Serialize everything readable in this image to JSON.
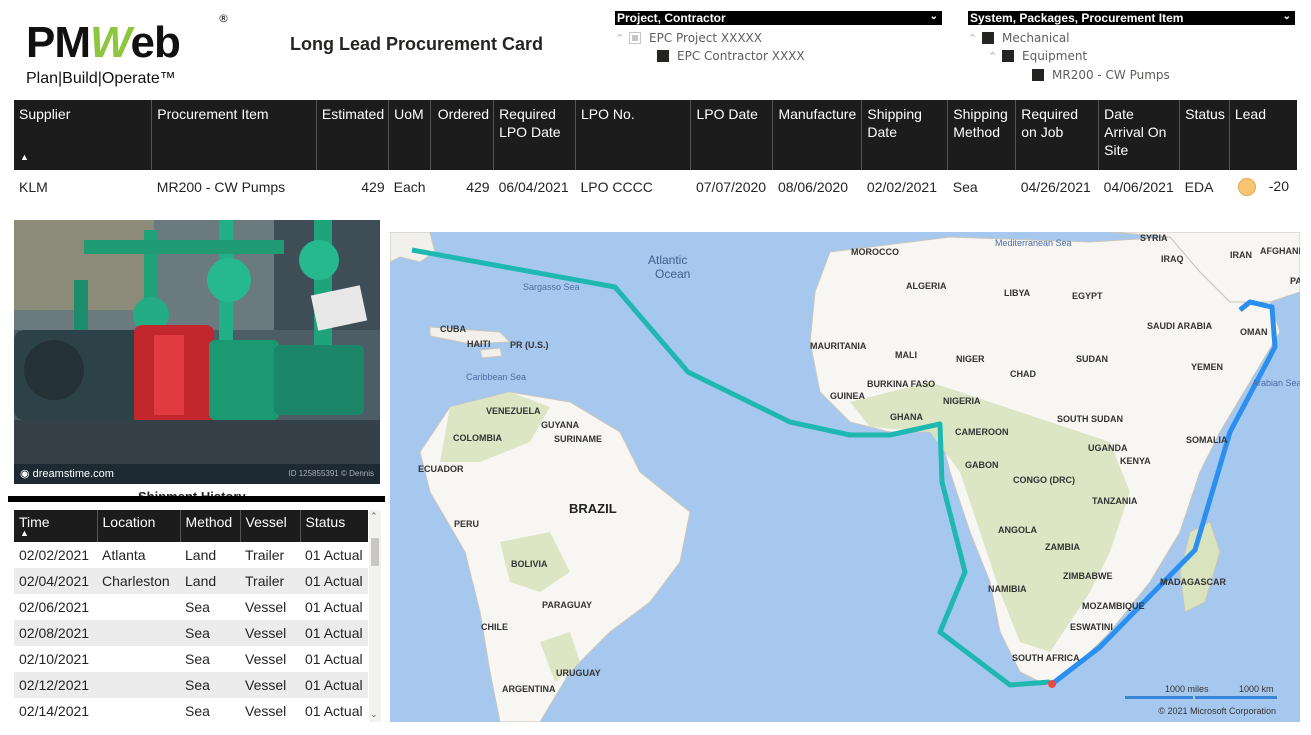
{
  "header": {
    "logo_pm": "PM",
    "logo_w": "W",
    "logo_eb": "eb",
    "logo_reg": "®",
    "logo_tagline": "Plan|Build|Operate™",
    "title": "Long Lead Procurement Card"
  },
  "slicer_project": {
    "title": "Project, Contractor",
    "items": [
      "EPC Project XXXXX",
      "EPC Contractor XXXX"
    ]
  },
  "slicer_system": {
    "title": "System, Packages, Procurement Item",
    "items": [
      "Mechanical",
      "Equipment",
      "MR200 - CW Pumps"
    ]
  },
  "procurement_table": {
    "columns": [
      "Supplier",
      "Procurement Item",
      "Estimated",
      "UoM",
      "Ordered",
      "Required LPO Date",
      "LPO No.",
      "LPO Date",
      "Manufacture",
      "Shipping Date",
      "Shipping Method",
      "Required on Job",
      "Date Arrival On Site",
      "Status",
      "Lead"
    ],
    "row": {
      "supplier": "KLM",
      "item": "MR200 - CW Pumps",
      "estimated": "429",
      "uom": "Each",
      "ordered": "429",
      "required_lpo_date": "06/04/2021",
      "lpo_no": "LPO CCCC",
      "lpo_date": "07/07/2020",
      "manufacture": "08/06/2020",
      "shipping_date": "02/02/2021",
      "shipping_method": "Sea",
      "required_on_job": "04/26/2021",
      "arrival_on_site": "04/06/2021",
      "status": "EDA",
      "lead": "-20",
      "lead_color": "#f8c574"
    }
  },
  "photo": {
    "watermark": "dreamstime.com",
    "id_text": "ID 125855391 © Dennis"
  },
  "shipment_history": {
    "title": "Shipment History",
    "columns": [
      "Time",
      "Location",
      "Method",
      "Vessel",
      "Status"
    ],
    "rows": [
      [
        "02/02/2021",
        "Atlanta",
        "Land",
        "Trailer",
        "01 Actual"
      ],
      [
        "02/04/2021",
        "Charleston",
        "Land",
        "Trailer",
        "01 Actual"
      ],
      [
        "02/06/2021",
        "",
        "Sea",
        "Vessel",
        "01 Actual"
      ],
      [
        "02/08/2021",
        "",
        "Sea",
        "Vessel",
        "01 Actual"
      ],
      [
        "02/10/2021",
        "",
        "Sea",
        "Vessel",
        "01 Actual"
      ],
      [
        "02/12/2021",
        "",
        "Sea",
        "Vessel",
        "01 Actual"
      ],
      [
        "02/14/2021",
        "",
        "Sea",
        "Vessel",
        "01 Actual"
      ]
    ]
  },
  "map": {
    "ocean_labels": [
      "Atlantic",
      "Ocean"
    ],
    "sea_labels": [
      "Sargasso Sea",
      "Caribbean Sea",
      "Mediterranean Sea",
      "Arabian Sea"
    ],
    "countries": [
      "MOROCCO",
      "ALGERIA",
      "LIBYA",
      "EGYPT",
      "SYRIA",
      "IRAQ",
      "IRAN",
      "AFGHANI",
      "PA",
      "SAUDI ARABIA",
      "OMAN",
      "YEMEN",
      "MAURITANIA",
      "MALI",
      "NIGER",
      "CHAD",
      "SUDAN",
      "BURKINA FASO",
      "GUINEA",
      "GHANA",
      "NIGERIA",
      "SOUTH SUDAN",
      "CAMEROON",
      "GABON",
      "CONGO (DRC)",
      "UGANDA",
      "KENYA",
      "SOMALIA",
      "TANZANIA",
      "ANGOLA",
      "ZAMBIA",
      "ZIMBABWE",
      "NAMIBIA",
      "MADAGASCAR",
      "MOZAMBIQUE",
      "ESWATINI",
      "SOUTH AFRICA",
      "CUBA",
      "HAITI",
      "PR (U.S.)",
      "VENEZUELA",
      "GUYANA",
      "SURINAME",
      "COLOMBIA",
      "ECUADOR",
      "PERU",
      "BOLIVIA",
      "PARAGUAY",
      "CHILE",
      "URUGUAY",
      "ARGENTINA"
    ],
    "brazil_label": "BRAZIL",
    "route_color_1": "#1fb8b0",
    "route_color_2": "#2b8ff0",
    "scale_miles": "1000 miles",
    "scale_km": "1000 km",
    "copyright": "© 2021 Microsoft Corporation"
  }
}
